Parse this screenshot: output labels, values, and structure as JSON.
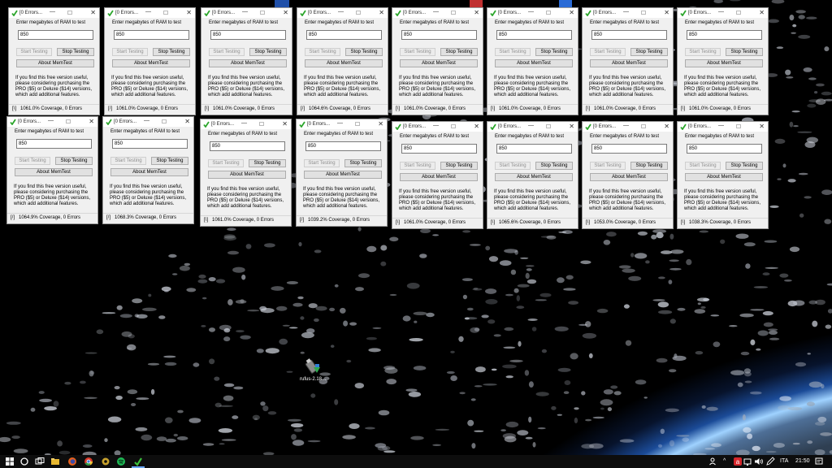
{
  "windows": [
    {
      "title": "[0 Errors...",
      "prompt": "Enter megabytes of RAM to test",
      "mb": "850",
      "start": "Start Testing",
      "stop": "Stop Testing",
      "about": "About MemTest",
      "promo": "If you find this free version useful, please considering purchasing the PRO ($5) or Deluxe ($14) versions, which add additional features.",
      "spinner": "[\\]",
      "status": "1061.0% Coverage, 0 Errors"
    },
    {
      "title": "[0 Errors...",
      "prompt": "Enter megabytes of RAM to test",
      "mb": "850",
      "start": "Start Testing",
      "stop": "Stop Testing",
      "about": "About MemTest",
      "promo": "If you find this free version useful, please considering purchasing the PRO ($5) or Deluxe ($14) versions, which add additional features.",
      "spinner": "[/]",
      "status": "1061.0% Coverage, 0 Errors"
    },
    {
      "title": "[0 Errors...",
      "prompt": "Enter megabytes of RAM to test",
      "mb": "850",
      "start": "Start Testing",
      "stop": "Stop Testing",
      "about": "About MemTest",
      "promo": "If you find this free version useful, please considering purchasing the PRO ($5) or Deluxe ($14) versions, which add additional features.",
      "spinner": "[\\]",
      "status": "1061.0% Coverage, 0 Errors"
    },
    {
      "title": "[0 Errors...",
      "prompt": "Enter megabytes of RAM to test",
      "mb": "850",
      "start": "Start Testing",
      "stop": "Stop Testing",
      "about": "About MemTest",
      "promo": "If you find this free version useful, please considering purchasing the PRO ($5) or Deluxe ($14) versions, which add additional features.",
      "spinner": "[/]",
      "status": "1064.6% Coverage, 0 Errors"
    },
    {
      "title": "[0 Errors...",
      "prompt": "Enter megabytes of RAM to test",
      "mb": "850",
      "start": "Start Testing",
      "stop": "Stop Testing",
      "about": "About MemTest",
      "promo": "If you find this free version useful, please considering purchasing the PRO ($5) or Deluxe ($14) versions, which add additional features.",
      "spinner": "[\\]",
      "status": "1061.0% Coverage, 0 Errors"
    },
    {
      "title": "[0 Errors...",
      "prompt": "Enter megabytes of RAM to test",
      "mb": "850",
      "start": "Start Testing",
      "stop": "Stop Testing",
      "about": "About MemTest",
      "promo": "If you find this free version useful, please considering purchasing the PRO ($5) or Deluxe ($14) versions, which add additional features.",
      "spinner": "[\\]",
      "status": "1061.0% Coverage, 0 Errors"
    },
    {
      "title": "[0 Errors...",
      "prompt": "Enter megabytes of RAM to test",
      "mb": "850",
      "start": "Start Testing",
      "stop": "Stop Testing",
      "about": "About MemTest",
      "promo": "If you find this free version useful, please considering purchasing the PRO ($5) or Deluxe ($14) versions, which add additional features.",
      "spinner": "[\\]",
      "status": "1061.0% Coverage, 0 Errors"
    },
    {
      "title": "[0 Errors...",
      "prompt": "Enter megabytes of RAM to test",
      "mb": "850",
      "start": "Start Testing",
      "stop": "Stop Testing",
      "about": "About MemTest",
      "promo": "If you find this free version useful, please considering purchasing the PRO ($5) or Deluxe ($14) versions, which add additional features.",
      "spinner": "[\\]",
      "status": "1061.0% Coverage, 0 Errors"
    },
    {
      "title": "[0 Errors...",
      "prompt": "Enter megabytes of RAM to test",
      "mb": "850",
      "start": "Start Testing",
      "stop": "Stop Testing",
      "about": "About MemTest",
      "promo": "If you find this free version useful, please considering purchasing the PRO ($5) or Deluxe ($14) versions, which add additional features.",
      "spinner": "[/]",
      "status": "1064.9% Coverage, 0 Errors"
    },
    {
      "title": "[0 Errors...",
      "prompt": "Enter megabytes of RAM to test",
      "mb": "850",
      "start": "Start Testing",
      "stop": "Stop Testing",
      "about": "About MemTest",
      "promo": "If you find this free version useful, please considering purchasing the PRO ($5) or Deluxe ($14) versions, which add additional features.",
      "spinner": "[/]",
      "status": "1068.3% Coverage, 0 Errors"
    },
    {
      "title": "[0 Errors...",
      "prompt": "Enter megabytes of RAM to test",
      "mb": "850",
      "start": "Start Testing",
      "stop": "Stop Testing",
      "about": "About MemTest",
      "promo": "If you find this free version useful, please considering purchasing the PRO ($5) or Deluxe ($14) versions, which add additional features.",
      "spinner": "[\\]",
      "status": "1061.0% Coverage, 0 Errors"
    },
    {
      "title": "[0 Errors...",
      "prompt": "Enter megabytes of RAM to test",
      "mb": "850",
      "start": "Start Testing",
      "stop": "Stop Testing",
      "about": "About MemTest",
      "promo": "If you find this free version useful, please considering purchasing the PRO ($5) or Deluxe ($14) versions, which add additional features.",
      "spinner": "[/]",
      "status": "1039.2% Coverage, 0 Errors"
    },
    {
      "title": "[0 Errors...",
      "prompt": "Enter megabytes of RAM to test",
      "mb": "850",
      "start": "Start Testing",
      "stop": "Stop Testing",
      "about": "About MemTest",
      "promo": "If you find this free version useful, please considering purchasing the PRO ($5) or Deluxe ($14) versions, which add additional features.",
      "spinner": "[\\]",
      "status": "1061.0% Coverage, 0 Errors"
    },
    {
      "title": "[0 Errors...",
      "prompt": "Enter megabytes of RAM to test",
      "mb": "850",
      "start": "Start Testing",
      "stop": "Stop Testing",
      "about": "About MemTest",
      "promo": "If you find this free version useful, please considering purchasing the PRO ($5) or Deluxe ($14) versions, which add additional features.",
      "spinner": "[\\]",
      "status": "1065.6% Coverage, 0 Errors"
    },
    {
      "title": "[0 Errors...",
      "prompt": "Enter megabytes of RAM to test",
      "mb": "850",
      "start": "Start Testing",
      "stop": "Stop Testing",
      "about": "About MemTest",
      "promo": "If you find this free version useful, please considering purchasing the PRO ($5) or Deluxe ($14) versions, which add additional features.",
      "spinner": "[\\]",
      "status": "1053.0% Coverage, 0 Errors"
    },
    {
      "title": "[0 Errors...",
      "prompt": "Enter megabytes of RAM to test",
      "mb": "850",
      "start": "Start Testing",
      "stop": "Stop Testing",
      "about": "About MemTest",
      "promo": "If you find this free version useful, please considering purchasing the PRO ($5) or Deluxe ($14) versions, which add additional features.",
      "spinner": "[\\]",
      "status": "1038.3% Coverage, 0 Errors"
    }
  ],
  "desktop_icon": {
    "label": "rufus-2.18...",
    "icon": "usb-drive-icon"
  },
  "taskbar": {
    "apps": [
      "start-icon",
      "cortana-icon",
      "task-view-icon",
      "file-explorer-icon",
      "firefox-icon",
      "chrome-icon",
      "settings-icon",
      "spotify-icon",
      "memtest-icon"
    ],
    "language": "ITA",
    "time": "21:50"
  },
  "colors": {
    "accent": "#1e7e1e",
    "window_bg": "#f0f0f0",
    "taskbar": "#0d0d0d"
  }
}
